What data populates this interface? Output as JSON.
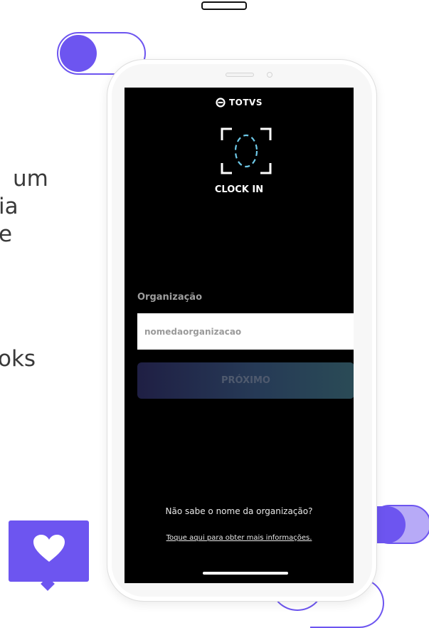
{
  "background": {
    "text_fragments": [
      "um",
      "ia",
      "e",
      "oks"
    ]
  },
  "app": {
    "logo_text": "TOTVS",
    "title": "CLOCK IN",
    "organization_label": "Organização",
    "organization_placeholder": "nomedaorganizacao",
    "next_button_label": "PRÓXIMO",
    "help_text": "Não sabe o nome da organização?",
    "help_link": "Toque aqui para obter mais informações."
  },
  "colors": {
    "accent": "#6d55f0",
    "accent_light": "#b7aaf7",
    "screen_bg": "#000000",
    "frame_dash": "#6ec9e8"
  },
  "icons": [
    "totvs-logo-icon",
    "face-id-frame-icon",
    "heart-icon"
  ]
}
